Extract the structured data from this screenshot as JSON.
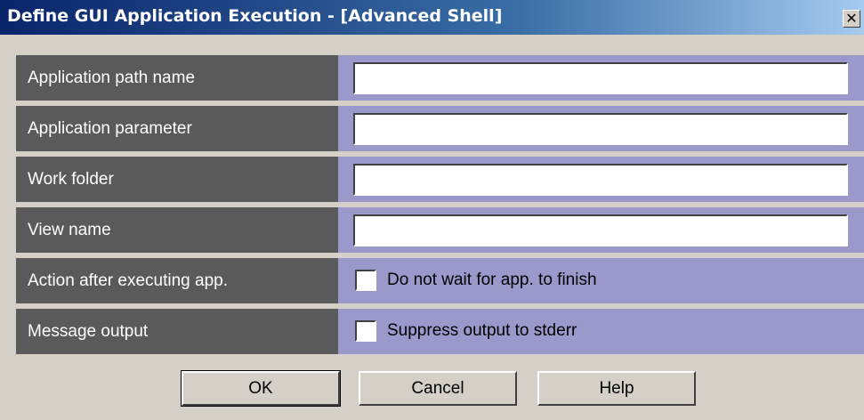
{
  "window": {
    "title": "Define GUI Application Execution - [Advanced Shell]",
    "close_label": "✕"
  },
  "form": {
    "rows": [
      {
        "label": "Application path name",
        "value": ""
      },
      {
        "label": "Application parameter",
        "value": ""
      },
      {
        "label": "Work folder",
        "value": ""
      },
      {
        "label": "View name",
        "value": ""
      },
      {
        "label": "Action after executing app.",
        "checkbox_label": "Do not wait for app. to finish",
        "checked": false
      },
      {
        "label": "Message output",
        "checkbox_label": "Suppress output to stderr",
        "checked": false
      }
    ]
  },
  "buttons": {
    "ok": "OK",
    "cancel": "Cancel",
    "help": "Help"
  },
  "colors": {
    "label_bg": "#5a5a5a",
    "value_bg": "#9b98cc",
    "titlebar": "#0a246a"
  }
}
